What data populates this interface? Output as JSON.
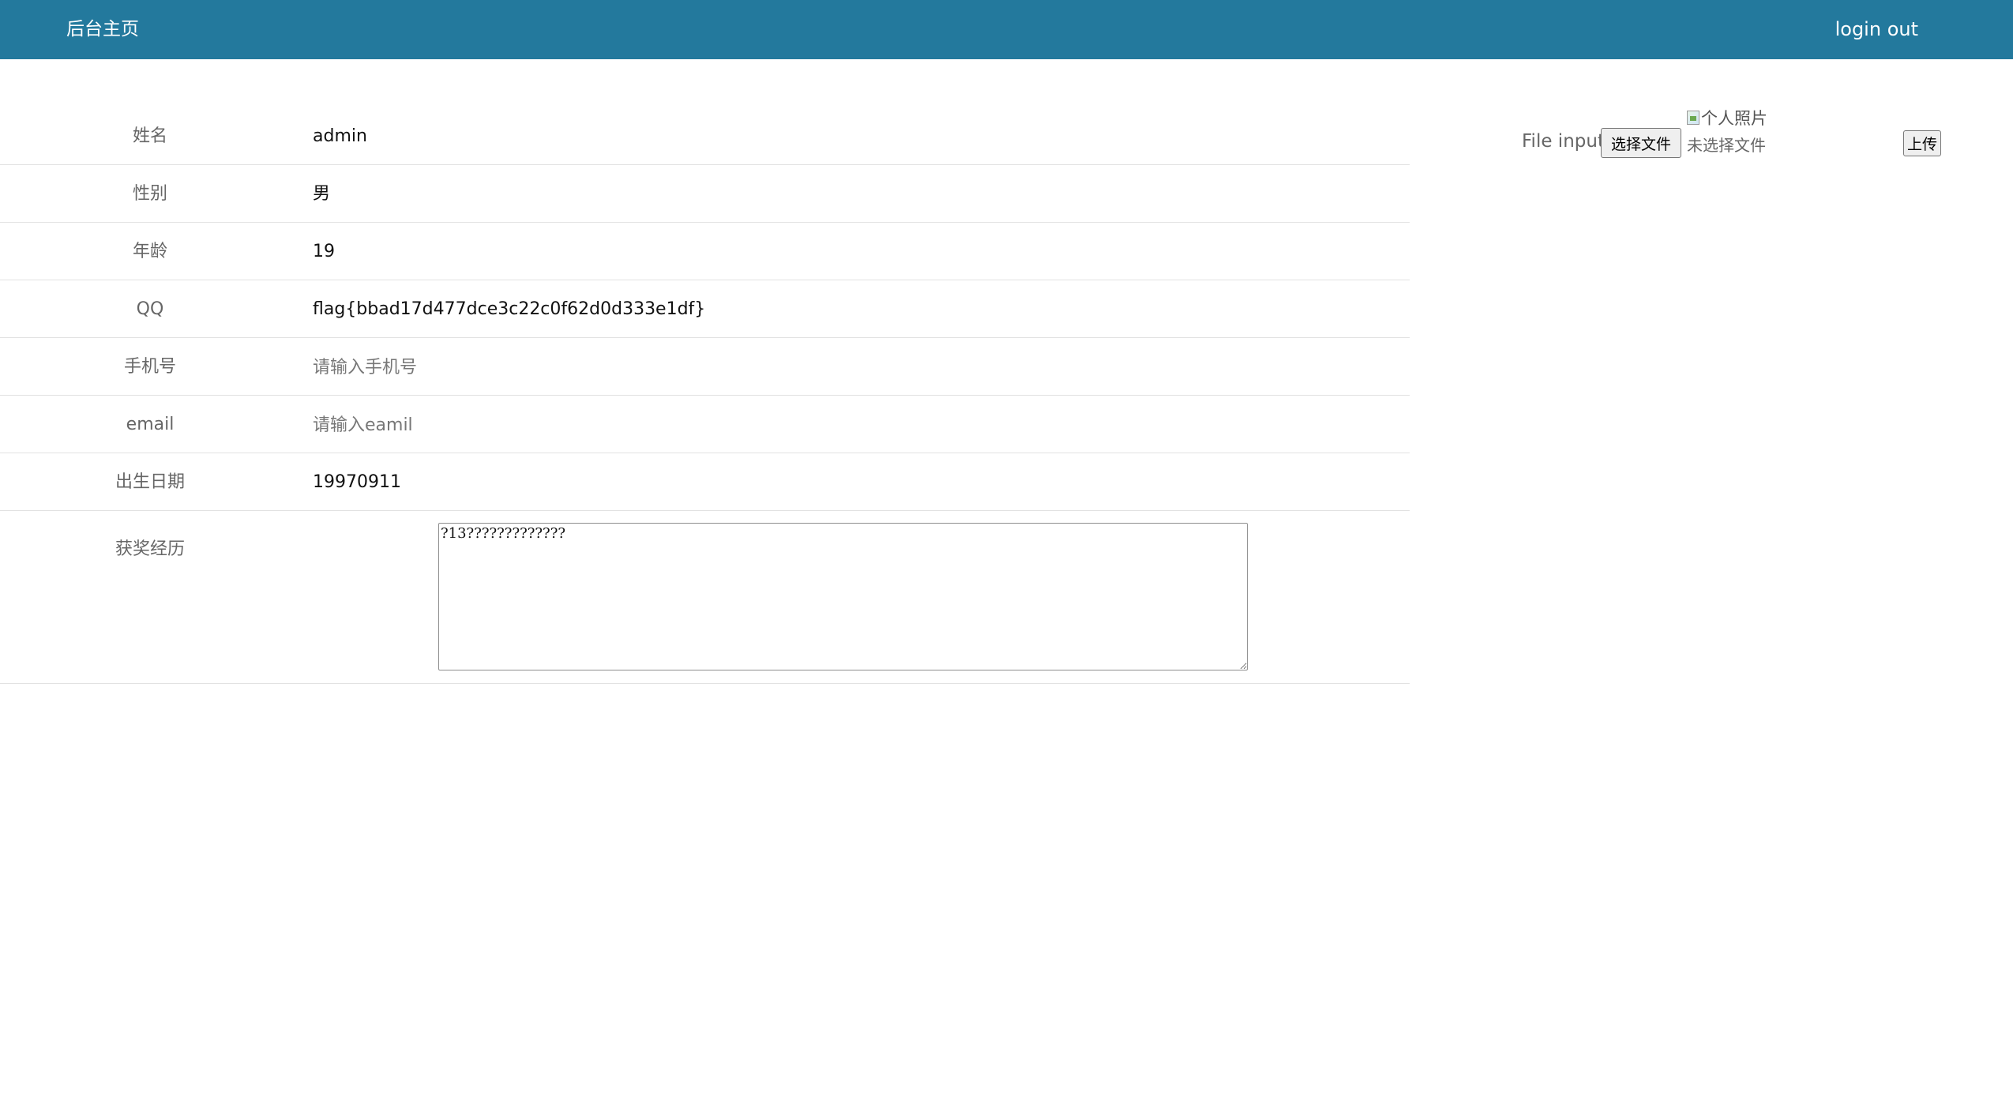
{
  "header": {
    "home_label": "后台主页",
    "logout_label": "login out",
    "background_color": "#23799d"
  },
  "profile": {
    "rows": [
      {
        "label": "姓名",
        "value": "admin"
      },
      {
        "label": "性别",
        "value": "男"
      },
      {
        "label": "年龄",
        "value": "19"
      },
      {
        "label": "QQ",
        "value": "flag{bbad17d477dce3c22c0f62d0d333e1df}"
      },
      {
        "label": "手机号",
        "value": "",
        "placeholder": "请输入手机号"
      },
      {
        "label": "email",
        "value": "",
        "placeholder": "请输入eamil"
      },
      {
        "label": "出生日期",
        "value": "19970911"
      }
    ],
    "awards": {
      "label": "获奖经历",
      "value": "?13?????????????"
    }
  },
  "photo_panel": {
    "photo_alt": "个人照片",
    "photo_icon": "broken-image-icon",
    "file_input_label": "File input",
    "choose_file_button": "选择文件",
    "file_status": "未选择文件",
    "upload_button": "上传"
  }
}
